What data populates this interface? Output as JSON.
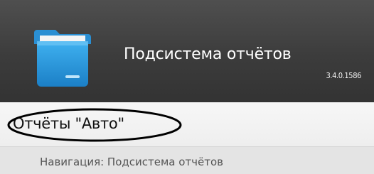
{
  "header": {
    "title": "Подсистема отчётов",
    "version": "3.4.0.1586",
    "icon": "folder-icon"
  },
  "menu": {
    "section_link": "Отчёты \"Авто\""
  },
  "navigation": {
    "text": "Навигация: Подсистема отчётов"
  },
  "colors": {
    "header_bg": "#3c3c3c",
    "icon_blue": "#2e9ee0",
    "highlight_ellipse": "#000000"
  }
}
